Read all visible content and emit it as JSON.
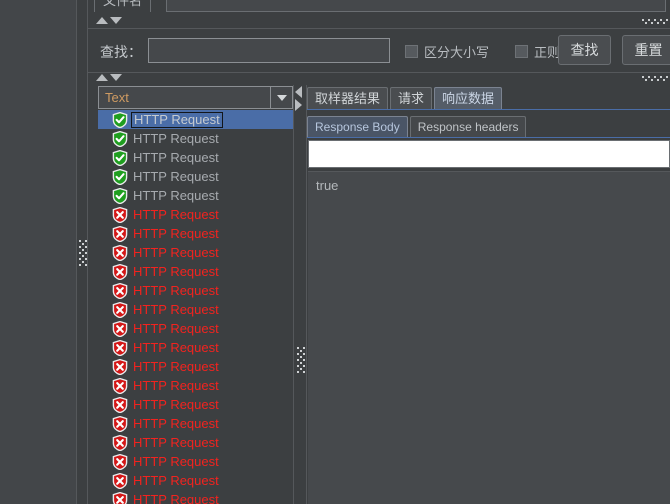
{
  "window": {
    "theme_bg": "#3c3f41",
    "accent": "#4a6da7",
    "error_color": "#f2231f",
    "ok_color": "#3a9e3a"
  },
  "filename_panel": {
    "tab_label": "文件名",
    "field_value": ""
  },
  "search_panel": {
    "label": "查找：",
    "input_value": "",
    "input_placeholder": "",
    "case_sensitive": {
      "label": "区分大小写",
      "checked": false
    },
    "regex": {
      "label": "正则表达式",
      "checked": false
    },
    "find_button": "查找",
    "reset_button": "重置"
  },
  "tree_pane": {
    "combo_selected": "Text",
    "combo_options": [
      "Text"
    ],
    "rows": [
      {
        "label": "HTTP Request",
        "status": "ok",
        "selected": true
      },
      {
        "label": "HTTP Request",
        "status": "ok",
        "selected": false
      },
      {
        "label": "HTTP Request",
        "status": "ok",
        "selected": false
      },
      {
        "label": "HTTP Request",
        "status": "ok",
        "selected": false
      },
      {
        "label": "HTTP Request",
        "status": "ok",
        "selected": false
      },
      {
        "label": "HTTP Request",
        "status": "error",
        "selected": false
      },
      {
        "label": "HTTP Request",
        "status": "error",
        "selected": false
      },
      {
        "label": "HTTP Request",
        "status": "error",
        "selected": false
      },
      {
        "label": "HTTP Request",
        "status": "error",
        "selected": false
      },
      {
        "label": "HTTP Request",
        "status": "error",
        "selected": false
      },
      {
        "label": "HTTP Request",
        "status": "error",
        "selected": false
      },
      {
        "label": "HTTP Request",
        "status": "error",
        "selected": false
      },
      {
        "label": "HTTP Request",
        "status": "error",
        "selected": false
      },
      {
        "label": "HTTP Request",
        "status": "error",
        "selected": false
      },
      {
        "label": "HTTP Request",
        "status": "error",
        "selected": false
      },
      {
        "label": "HTTP Request",
        "status": "error",
        "selected": false
      },
      {
        "label": "HTTP Request",
        "status": "error",
        "selected": false
      },
      {
        "label": "HTTP Request",
        "status": "error",
        "selected": false
      },
      {
        "label": "HTTP Request",
        "status": "error",
        "selected": false
      },
      {
        "label": "HTTP Request",
        "status": "error",
        "selected": false
      },
      {
        "label": "HTTP Request",
        "status": "error",
        "selected": false
      }
    ]
  },
  "detail_pane": {
    "tabs": [
      {
        "label": "取样器结果",
        "active": false
      },
      {
        "label": "请求",
        "active": false
      },
      {
        "label": "响应数据",
        "active": true
      }
    ],
    "subtabs": [
      {
        "label": "Response Body",
        "active": true
      },
      {
        "label": "Response headers",
        "active": false
      }
    ],
    "search_field_value": "",
    "body_text": "true"
  },
  "icons": {
    "status_ok": "shield-check-icon",
    "status_error": "shield-error-icon",
    "combo": "chevron-down-icon",
    "split_up": "triangle-up-icon",
    "split_down": "triangle-down-icon",
    "split_left": "triangle-left-icon",
    "split_right": "triangle-right-icon"
  }
}
